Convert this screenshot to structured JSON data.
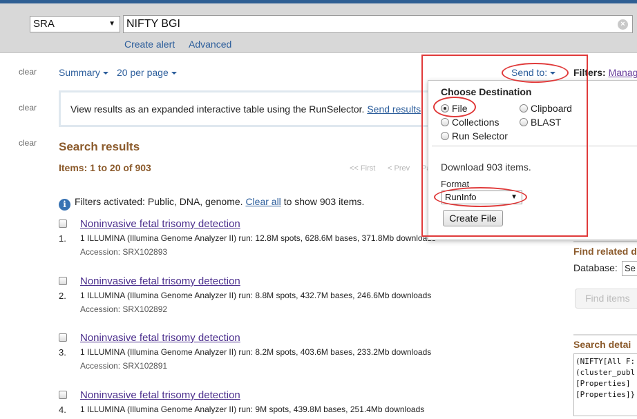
{
  "search": {
    "db_value": "SRA",
    "query": "NIFTY BGI",
    "links": [
      "Create alert",
      "Advanced"
    ]
  },
  "clear_label": "clear",
  "summary": {
    "format": "Summary",
    "per_page": "20 per page"
  },
  "runselector": {
    "text": "View results as an expanded interactive table using the RunSelector.",
    "link": "Send results"
  },
  "results": {
    "title": "Search results",
    "count": "Items: 1 to 20 of 903",
    "pager_first": "<< First",
    "pager_prev": "< Prev",
    "pager_page": "Pa",
    "filters_note_pre": "Filters activated: Public, DNA, genome.",
    "filters_note_link": "Clear all",
    "filters_note_post": "to show 903 items.",
    "items": [
      {
        "num": "1.",
        "title": "Noninvasive fetal trisomy detection",
        "desc": "1 ILLUMINA (Illumina Genome Analyzer II) run: 12.8M spots, 628.6M bases, 371.8Mb downloads",
        "acc": "Accession: SRX102893"
      },
      {
        "num": "2.",
        "title": "Noninvasive fetal trisomy detection",
        "desc": "1 ILLUMINA (Illumina Genome Analyzer II) run: 8.8M spots, 432.7M bases, 246.6Mb downloads",
        "acc": "Accession: SRX102892"
      },
      {
        "num": "3.",
        "title": "Noninvasive fetal trisomy detection",
        "desc": "1 ILLUMINA (Illumina Genome Analyzer II) run: 8.2M spots, 403.6M bases, 233.2Mb downloads",
        "acc": "Accession: SRX102891"
      },
      {
        "num": "4.",
        "title": "Noninvasive fetal trisomy detection",
        "desc": "1 ILLUMINA (Illumina Genome Analyzer II) run: 9M spots, 439.8M bases, 251.4Mb downloads",
        "acc": ""
      }
    ]
  },
  "send_to": {
    "label": "Send to:",
    "popup": {
      "heading": "Choose Destination",
      "options": [
        "File",
        "Clipboard",
        "Collections",
        "BLAST",
        "Run Selector"
      ],
      "selected": "File",
      "download_text": "Download 903 items.",
      "format_label": "Format",
      "format_value": "RunInfo",
      "create_button": "Create File"
    }
  },
  "sidebar": {
    "filters_label": "Filters:",
    "filters_link": "Manag",
    "find_related": "Find related d",
    "database_label": "Database:",
    "database_value": "Se",
    "find_items_button": "Find items",
    "search_details_title": "Search detai",
    "search_details_text": [
      "(NIFTY[All F:",
      "(cluster_publ",
      "[Properties]",
      "[Properties]}"
    ]
  },
  "colors": {
    "annotation_red": "#e03a3a",
    "link_blue": "#2b5d9b",
    "heading_brown": "#8b5a2b",
    "visited_purple": "#4a2d8c"
  }
}
